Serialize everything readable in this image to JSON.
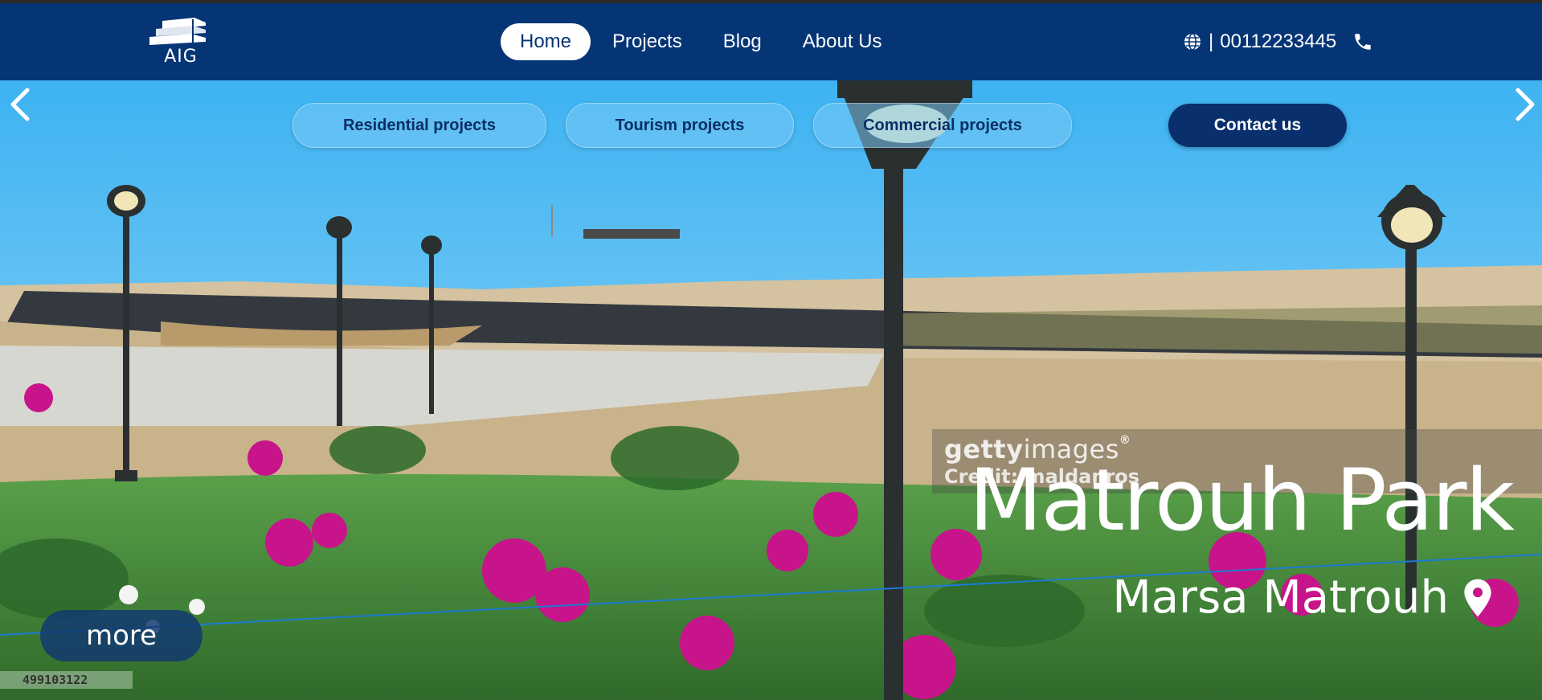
{
  "brand": {
    "logo_text": "AIG"
  },
  "nav": {
    "items": [
      {
        "label": "Home",
        "active": true
      },
      {
        "label": "Projects",
        "active": false
      },
      {
        "label": "Blog",
        "active": false
      },
      {
        "label": "About Us",
        "active": false
      }
    ]
  },
  "contact_bar": {
    "globe_icon": "globe-icon",
    "separator": "|",
    "phone_number": "00112233445",
    "phone_icon": "phone-icon"
  },
  "hero": {
    "subnav": [
      {
        "label": "Residential projects"
      },
      {
        "label": "Tourism projects"
      },
      {
        "label": "Commercial projects"
      }
    ],
    "contact_button": "Contact us",
    "watermark": {
      "brand_bold": "getty",
      "brand_light": "images",
      "mark": "®",
      "credit": "Credit: maldanros"
    },
    "project_title": "Matrouh Park",
    "project_location": "Marsa Matrouh",
    "location_icon": "map-pin-icon",
    "more_button": "more",
    "image_id": "499103122",
    "prev_icon": "chevron-left-icon",
    "next_icon": "chevron-right-icon"
  },
  "colors": {
    "header_bg": "#063576",
    "accent_dark": "#0a2f6d",
    "text_light": "#ffffff"
  }
}
